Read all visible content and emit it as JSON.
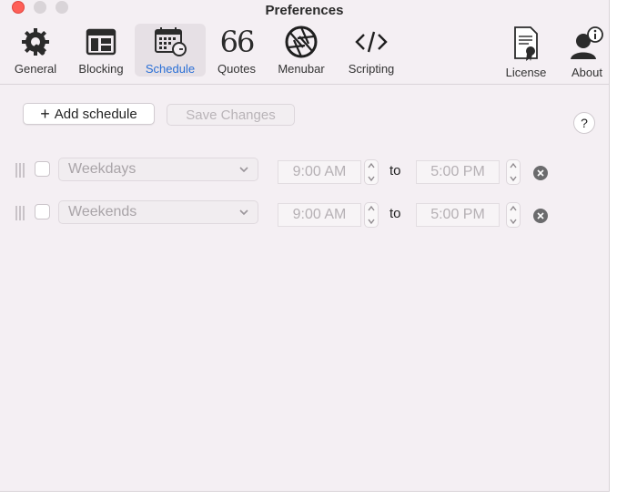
{
  "window": {
    "title": "Preferences"
  },
  "toolbar": {
    "items": [
      {
        "label": "General",
        "icon": "gear-wrench-icon"
      },
      {
        "label": "Blocking",
        "icon": "window-blocking-icon"
      },
      {
        "label": "Schedule",
        "icon": "calendar-clock-icon",
        "selected": true
      },
      {
        "label": "Quotes",
        "icon": "quote-marks-icon"
      },
      {
        "label": "Menubar",
        "icon": "aperture-icon"
      },
      {
        "label": "Scripting",
        "icon": "code-brackets-icon"
      },
      {
        "label": "License",
        "icon": "certificate-icon"
      },
      {
        "label": "About",
        "icon": "person-info-icon"
      }
    ],
    "accent_color": "#2a6fd6"
  },
  "actions": {
    "add_schedule": "Add schedule",
    "save_changes": "Save Changes",
    "help": "?"
  },
  "schedules": [
    {
      "enabled": false,
      "days": "Weekdays",
      "start": "9:00 AM",
      "separator": "to",
      "end": "5:00 PM"
    },
    {
      "enabled": false,
      "days": "Weekends",
      "start": "9:00 AM",
      "separator": "to",
      "end": "5:00 PM"
    }
  ]
}
